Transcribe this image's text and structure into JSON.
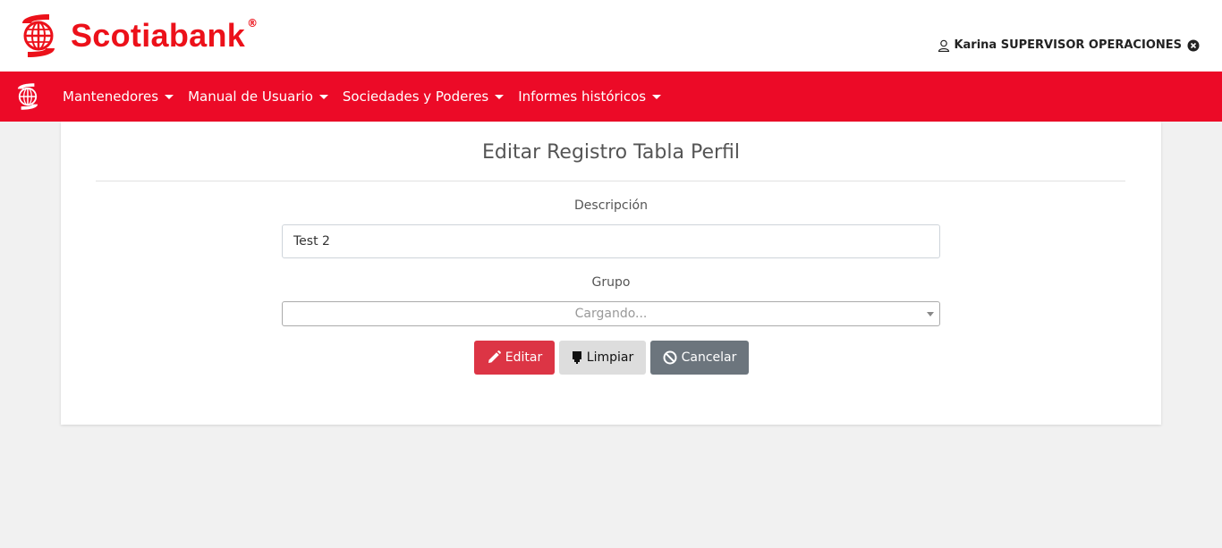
{
  "header": {
    "brand": "Scotiabank",
    "brand_reg": "®",
    "user_name": "Karina SUPERVISOR OPERACIONES"
  },
  "nav": {
    "items": [
      {
        "label": "Mantenedores"
      },
      {
        "label": "Manual de Usuario"
      },
      {
        "label": "Sociedades y Poderes"
      },
      {
        "label": "Informes históricos"
      }
    ]
  },
  "form": {
    "title": "Editar Registro Tabla Perfil",
    "descripcion_label": "Descripción",
    "descripcion_value": "Test 2",
    "grupo_label": "Grupo",
    "grupo_value": "Cargando...",
    "buttons": {
      "edit": "Editar",
      "clear": "Limpiar",
      "cancel": "Cancelar"
    }
  },
  "icons": {
    "logo": "scotiabank-logo-icon",
    "user": "user-icon",
    "logout": "close-circle-icon",
    "edit": "pencil-icon",
    "clear": "eraser-icon",
    "cancel": "ban-icon"
  },
  "colors": {
    "brand_red": "#ec111a",
    "navbar_red": "#ec0a27",
    "edit_button": "#dc3545",
    "clear_button": "#dddddd",
    "cancel_button": "#6c757d"
  }
}
